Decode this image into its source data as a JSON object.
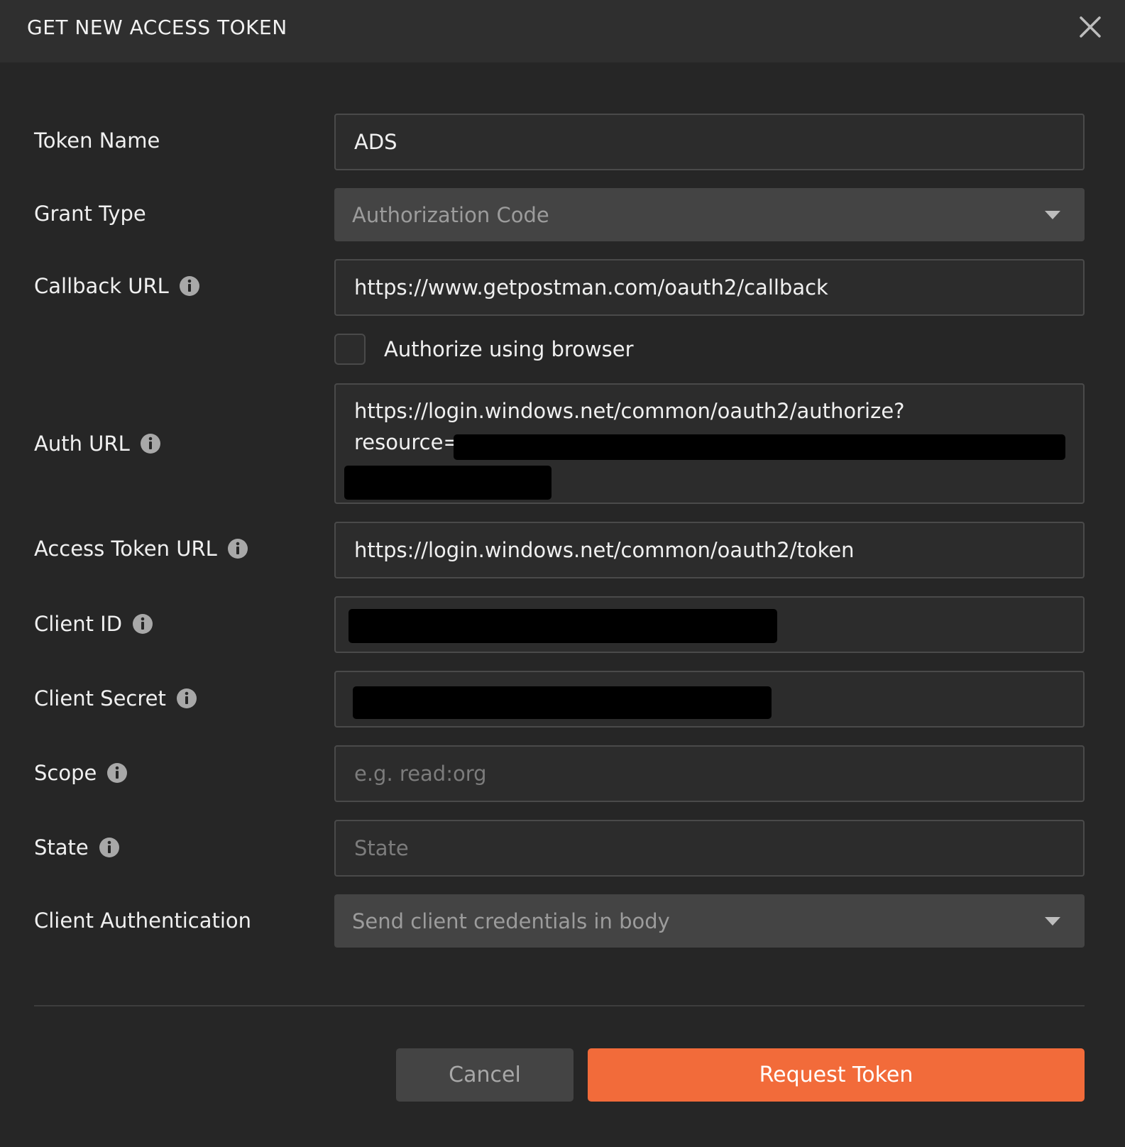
{
  "header": {
    "title": "GET NEW ACCESS TOKEN"
  },
  "form": {
    "token_name": {
      "label": "Token Name",
      "value": "ADS"
    },
    "grant_type": {
      "label": "Grant Type",
      "value": "Authorization Code"
    },
    "callback_url": {
      "label": "Callback URL",
      "value": "https://www.getpostman.com/oauth2/callback"
    },
    "authorize_browser": {
      "label": "Authorize using browser",
      "checked": false
    },
    "auth_url": {
      "label": "Auth URL",
      "line1": "https://login.windows.net/common/oauth2/authorize?",
      "line2": "resource="
    },
    "access_token_url": {
      "label": "Access Token URL",
      "value": "https://login.windows.net/common/oauth2/token"
    },
    "client_id": {
      "label": "Client ID"
    },
    "client_secret": {
      "label": "Client Secret"
    },
    "scope": {
      "label": "Scope",
      "placeholder": "e.g. read:org"
    },
    "state": {
      "label": "State",
      "placeholder": "State"
    },
    "client_auth": {
      "label": "Client Authentication",
      "value": "Send client credentials in body"
    }
  },
  "footer": {
    "cancel_label": "Cancel",
    "request_label": "Request Token"
  },
  "colors": {
    "accent": "#f26b3a",
    "background": "#262626",
    "header_background": "#2f2f2f"
  }
}
